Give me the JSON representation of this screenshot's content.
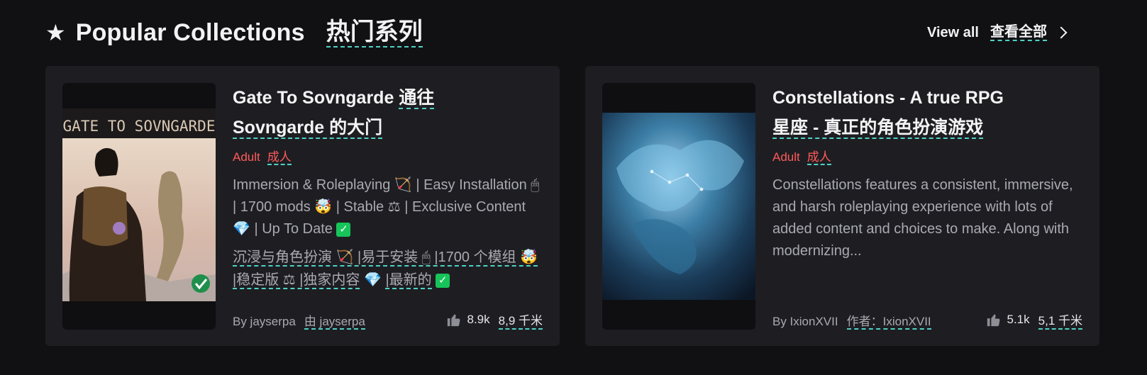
{
  "header": {
    "star_icon": "star-icon",
    "title": "Popular Collections",
    "title_zh": "热门系列",
    "view_all": "View all",
    "view_all_zh": "查看全部",
    "chevron_icon": "chevron-right-icon"
  },
  "cards": [
    {
      "thumb_title": "GATE TO SOVNGARDE",
      "title": "Gate To Sovngarde",
      "title_zh_1": "通往",
      "title_zh_2": "Sovngarde 的大门",
      "tag": "Adult",
      "tag_zh": "成人",
      "desc": "Immersion & Roleplaying 🏹 | Easy Installation 🖱 | 1700 mods 🤯 | Stable ⚖ | Exclusive Content",
      "desc_end": "| Up To Date",
      "desc_zh": "沉浸与角色扮演 🏹 |易于安装 🖱 |1700 个模组 🤯 |稳定版 ⚖ |独家内容",
      "desc_zh_end": "|最新的",
      "author": "By jayserpa",
      "author_zh": "由 jayserpa",
      "likes": "8.9k",
      "likes_zh": "8,9 千米",
      "colors": {
        "accent": "#4fd1c5",
        "adult": "#ff5a5a"
      }
    },
    {
      "title": "Constellations - A true RPG",
      "title_zh": "星座 - 真正的角色扮演游戏",
      "tag": "Adult",
      "tag_zh": "成人",
      "desc": "Constellations features a consistent, immersive, and harsh roleplaying experience with lots of added content and choices to make. Along with modernizing...",
      "author": "By IxionXVII",
      "author_zh": "作者：IxionXVII",
      "likes": "5.1k",
      "likes_zh": "5,1 千米"
    }
  ]
}
